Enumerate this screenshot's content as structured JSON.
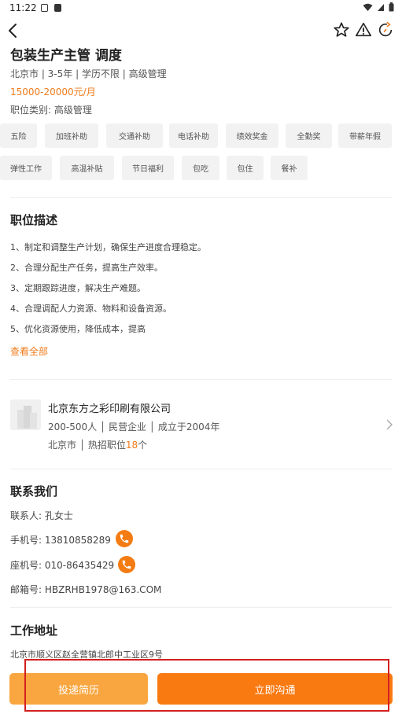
{
  "status_bar": {
    "time": "11:22"
  },
  "job": {
    "title": "包装生产主管 调度",
    "meta": "北京市 | 3-5年 | 学历不限 | 高级管理",
    "salary": "15000-20000元/月",
    "category": "职位类别:  高级管理",
    "benefits_row1": [
      "五险",
      "加班补助",
      "交通补助",
      "电话补助",
      "绩效奖金",
      "全勤奖",
      "带薪年假"
    ],
    "benefits_row2": [
      "弹性工作",
      "高温补贴",
      "节日福利",
      "包吃",
      "包住",
      "餐补"
    ]
  },
  "description": {
    "heading": "职位描述",
    "lines": [
      "1、制定和调整生产计划，确保生产进度合理稳定。",
      "2、合理分配生产任务，提高生产效率。",
      "3、定期跟踪进度，解决生产难题。",
      "4、合理调配人力资源、物料和设备资源。",
      "5、优化资源使用，降低成本，提高"
    ],
    "view_all": "查看全部"
  },
  "company": {
    "name": "北京东方之彩印刷有限公司",
    "info": "200-500人 │ 民营企业 │ 成立于2004年",
    "location_prefix": "北京市 │ 热招职位",
    "hot_jobs_count": "18",
    "location_suffix": "个"
  },
  "contact": {
    "heading": "联系我们",
    "person": "联系人:  孔女士",
    "mobile": "手机号:  13810858289",
    "landline": "座机号:  010-86435429",
    "email": "邮箱号:  HBZRHB1978@163.COM"
  },
  "address": {
    "heading": "工作地址",
    "text": "北京市顺义区赵全营镇北郎中工业区9号"
  },
  "actions": {
    "resume": "投递简历",
    "chat": "立即沟通"
  },
  "colors": {
    "accent": "#f07a1a",
    "resume_button": "#f9a640",
    "chat_button": "#fa7a12",
    "highlight_box": "#d42020"
  }
}
